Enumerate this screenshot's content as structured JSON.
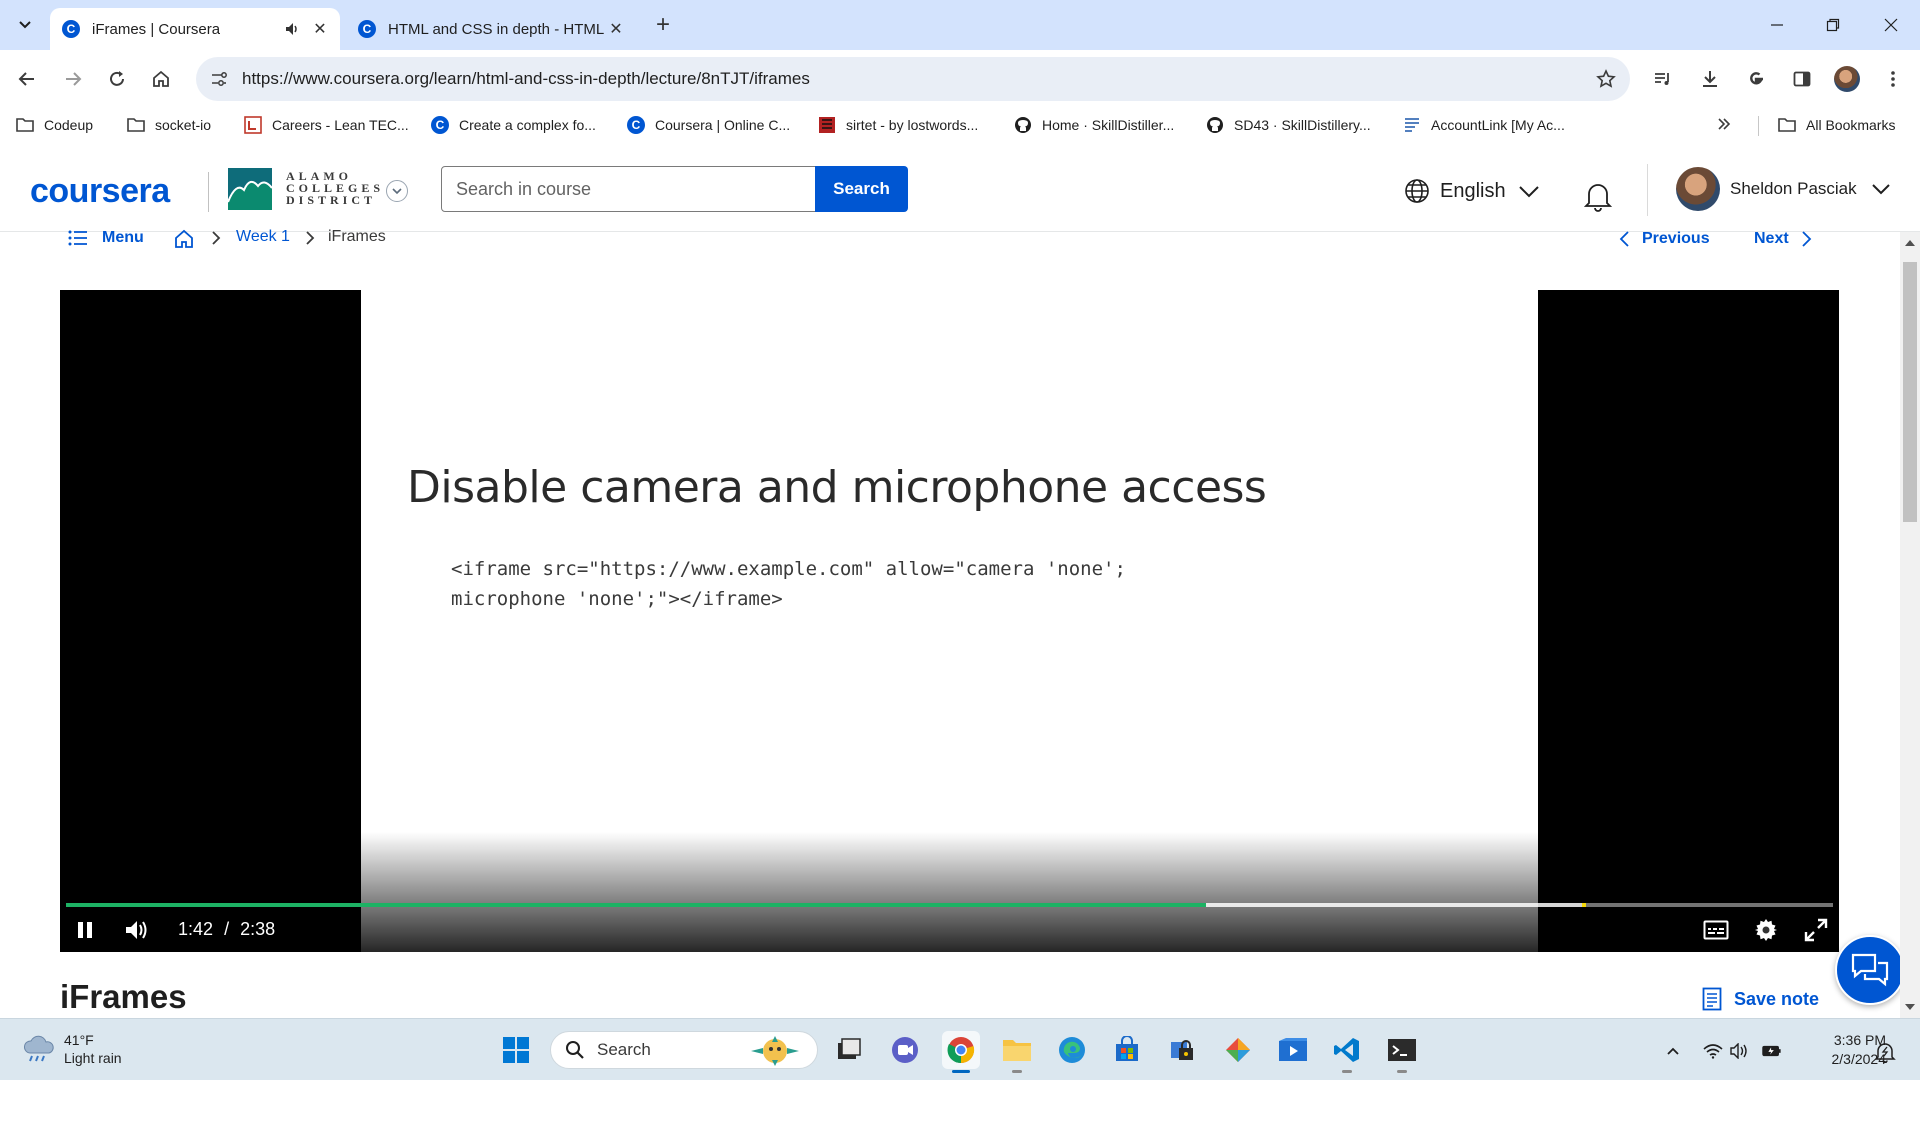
{
  "browser": {
    "tabs": [
      {
        "title": "iFrames | Coursera",
        "active": true,
        "audio": true
      },
      {
        "title": "HTML and CSS in depth - HTML",
        "active": false,
        "audio": false
      }
    ],
    "url": "https://www.coursera.org/learn/html-and-css-in-depth/lecture/8nTJT/iframes",
    "bookmarks": [
      {
        "label": "Codeup",
        "icon": "folder-icon"
      },
      {
        "label": "socket-io",
        "icon": "folder-icon"
      },
      {
        "label": "Careers - Lean TEC...",
        "icon": "lean-tec-favicon"
      },
      {
        "label": "Create a complex fo...",
        "icon": "coursera-favicon"
      },
      {
        "label": "Coursera | Online C...",
        "icon": "coursera-favicon"
      },
      {
        "label": "sirtet - by lostwords...",
        "icon": "sirtet-favicon"
      },
      {
        "label": "Home · SkillDistiller...",
        "icon": "github-icon"
      },
      {
        "label": "SD43 · SkillDistillery...",
        "icon": "github-icon"
      },
      {
        "label": "AccountLink [My Ac...",
        "icon": "accountlink-favicon"
      }
    ],
    "all_bookmarks_label": "All Bookmarks"
  },
  "coursera": {
    "logo": "coursera",
    "partner": {
      "line1": "ALAMO",
      "line2": "COLLEGES",
      "line3": "DISTRICT"
    },
    "search_placeholder": "Search in course",
    "search_button": "Search",
    "language": "English",
    "user_name": "Sheldon Pasciak",
    "brand_color": "#0056d2"
  },
  "breadcrumb": {
    "menu": "Menu",
    "week": "Week 1",
    "current": "iFrames",
    "previous": "Previous",
    "next": "Next"
  },
  "video": {
    "slide_title": "Disable camera and microphone access",
    "slide_code_line1": "<iframe src=\"https://www.example.com\" allow=\"camera 'none';",
    "slide_code_line2": "microphone 'none';\"></iframe>",
    "current_time": "1:42",
    "separator": "/",
    "duration": "2:38",
    "played_fraction": 0.645,
    "buffered_fraction": 0.86,
    "progress_color": "#1db264"
  },
  "lecture": {
    "title": "iFrames",
    "save_note": "Save note"
  },
  "taskbar": {
    "weather_temp": "41°F",
    "weather_desc": "Light rain",
    "search_label": "Search",
    "time": "3:36 PM",
    "date": "2/3/2024"
  }
}
